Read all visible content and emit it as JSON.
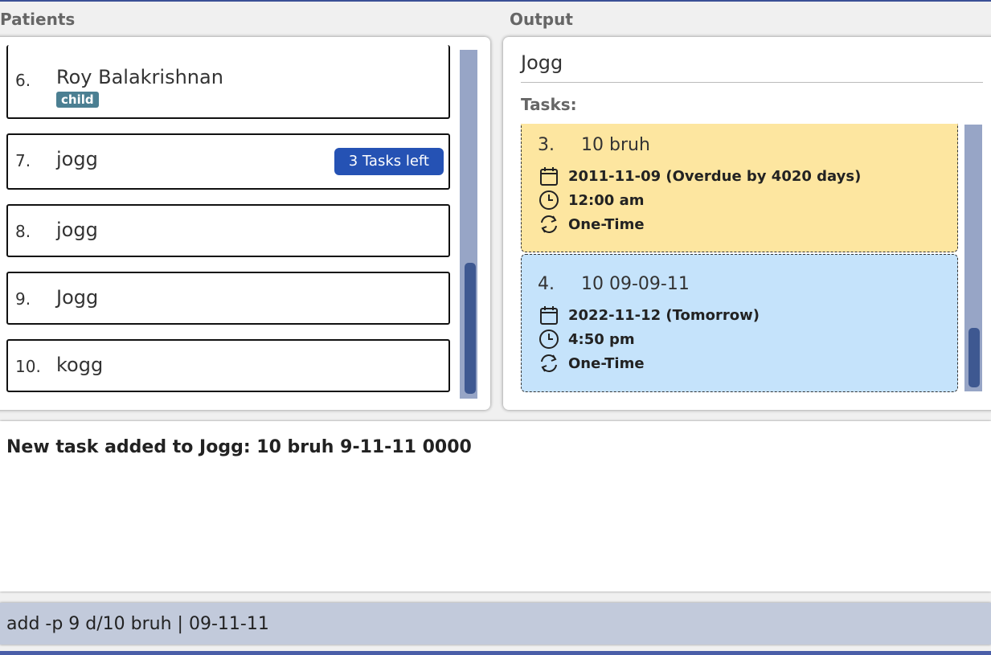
{
  "labels": {
    "patients": "Patients",
    "output": "Output"
  },
  "patients": [
    {
      "index": "6.",
      "name": "Roy Balakrishnan",
      "tag": "child"
    },
    {
      "index": "7.",
      "name": "jogg",
      "badge": "3 Tasks left"
    },
    {
      "index": "8.",
      "name": "jogg"
    },
    {
      "index": "9.",
      "name": "Jogg"
    },
    {
      "index": "10.",
      "name": "kogg"
    }
  ],
  "output": {
    "title": "Jogg",
    "tasks_label": "Tasks:",
    "tasks": [
      {
        "num": "3.",
        "title": "10 bruh",
        "date": "2011-11-09 (Overdue by 4020 days)",
        "time": "12:00 am",
        "recurrence": "One-Time",
        "color": "#fde6a0"
      },
      {
        "num": "4.",
        "title": "10 09-09-11",
        "date": "2022-11-12 (Tomorrow)",
        "time": "4:50 pm",
        "recurrence": "One-Time",
        "color": "#c5e3fb"
      }
    ]
  },
  "result": {
    "text": "New task added to Jogg: 10 bruh 9-11-11 0000"
  },
  "command": {
    "value": "add -p 9 d/10 bruh | 09-11-11"
  },
  "colors": {
    "accent": "#2552b4",
    "tag": "#4b7f92",
    "scrollbar": "#3e5891"
  },
  "icons": [
    "calendar-icon",
    "clock-icon",
    "repeat-icon"
  ]
}
